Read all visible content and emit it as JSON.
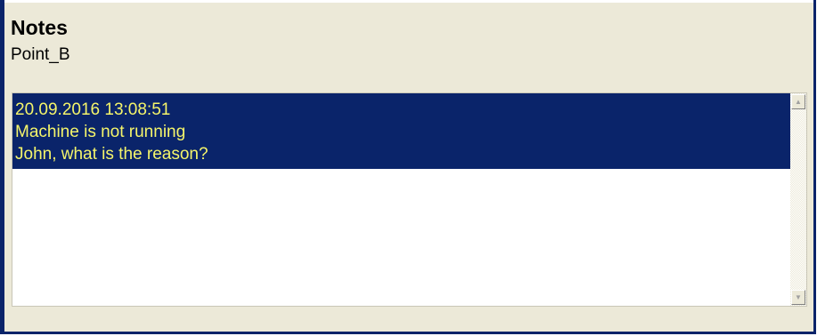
{
  "panel": {
    "title": "Notes",
    "subtitle": "Point_B"
  },
  "notes": {
    "entries": [
      {
        "timestamp": "20.09.2016 13:08:51",
        "line1": "Machine is not running",
        "line2": "John, what is the reason?"
      }
    ],
    "scrollbar": {
      "up_icon": "arrow-up-icon",
      "down_icon": "arrow-down-icon"
    }
  },
  "colors": {
    "window_bg": "#ece9d8",
    "frame": "#0a246a",
    "selection_bg": "#0a246a",
    "selection_text": "#f5f56a"
  }
}
